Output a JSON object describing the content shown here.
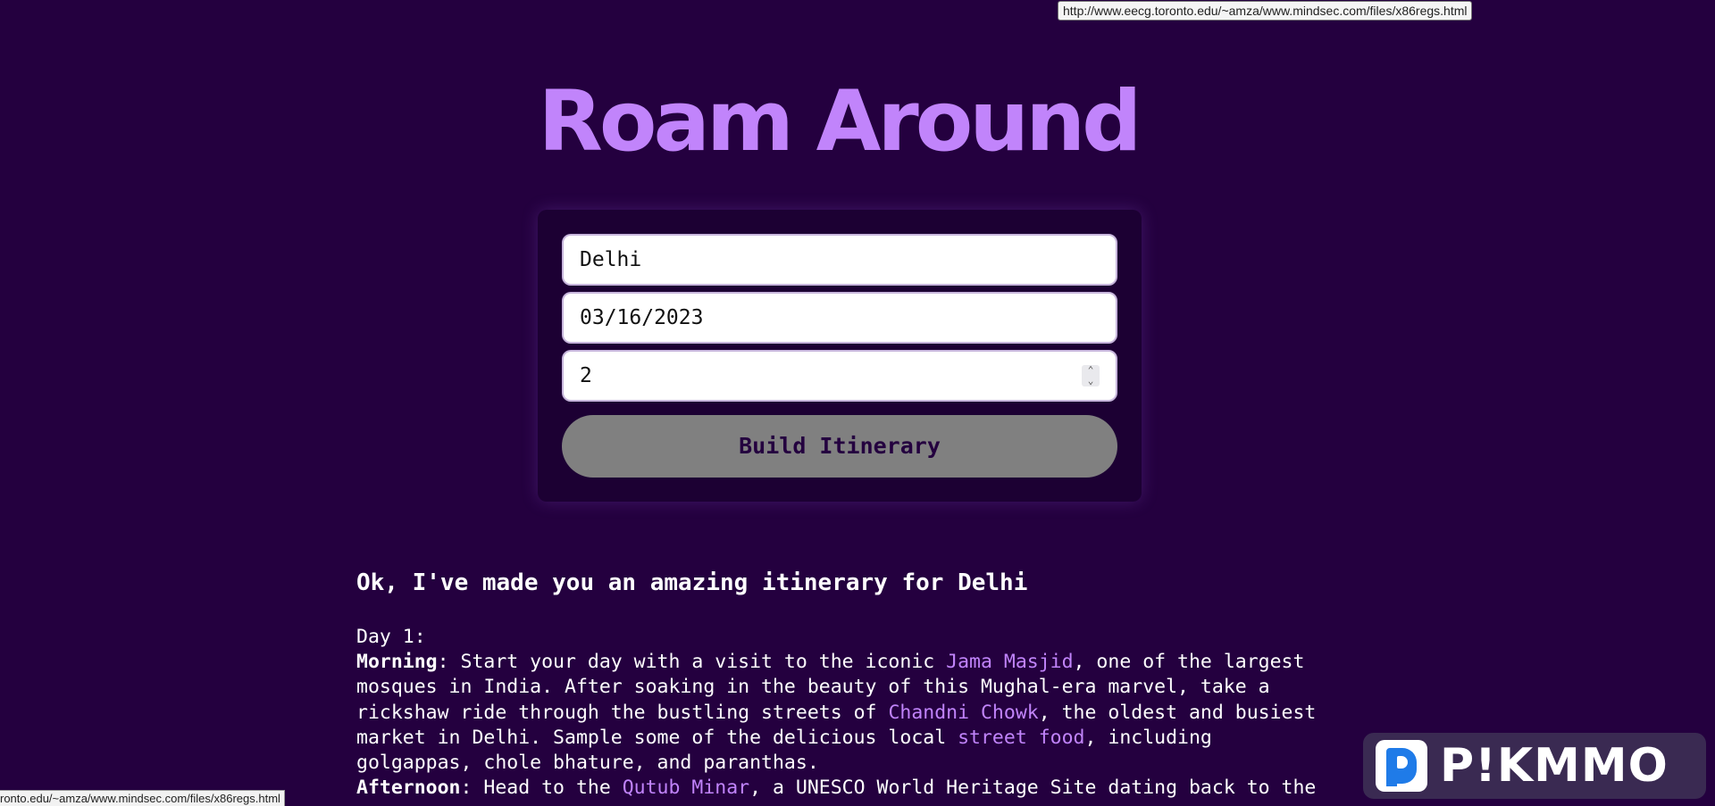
{
  "tooltip": {
    "url": "http://www.eecg.toronto.edu/~amza/www.mindsec.com/files/x86regs.html"
  },
  "header": {
    "title": "Roam Around"
  },
  "form": {
    "destination_value": "Delhi",
    "date_value": "03/16/2023",
    "days_value": "2",
    "submit_label": "Build Itinerary"
  },
  "result": {
    "heading": "Ok, I've made you an amazing itinerary for Delhi",
    "day_label": "Day 1:",
    "morning_label": "Morning",
    "morning_text_1": ": Start your day with a visit to the iconic ",
    "morning_link_1": "Jama Masjid",
    "morning_text_2": ", one of the largest mosques in India. After soaking in the beauty of this Mughal-era marvel, take a rickshaw ride through the bustling streets of ",
    "morning_link_2": "Chandni Chowk",
    "morning_text_3": ", the oldest and busiest market in Delhi. Sample some of the delicious local ",
    "morning_link_3": "street food",
    "morning_text_4": ", including golgappas, chole bhature, and paranthas.",
    "afternoon_label": "Afternoon",
    "afternoon_text_1": ": Head to the ",
    "afternoon_link_1": "Qutub Minar",
    "afternoon_text_2": ", a UNESCO World Heritage Site dating back to the"
  },
  "status_bar": {
    "url": "ronto.edu/~amza/www.mindsec.com/files/x86regs.html"
  },
  "watermark": {
    "text": "P!KMMO"
  },
  "colors": {
    "background": "#24003f",
    "accent": "#c184fb",
    "button": "#808080"
  }
}
